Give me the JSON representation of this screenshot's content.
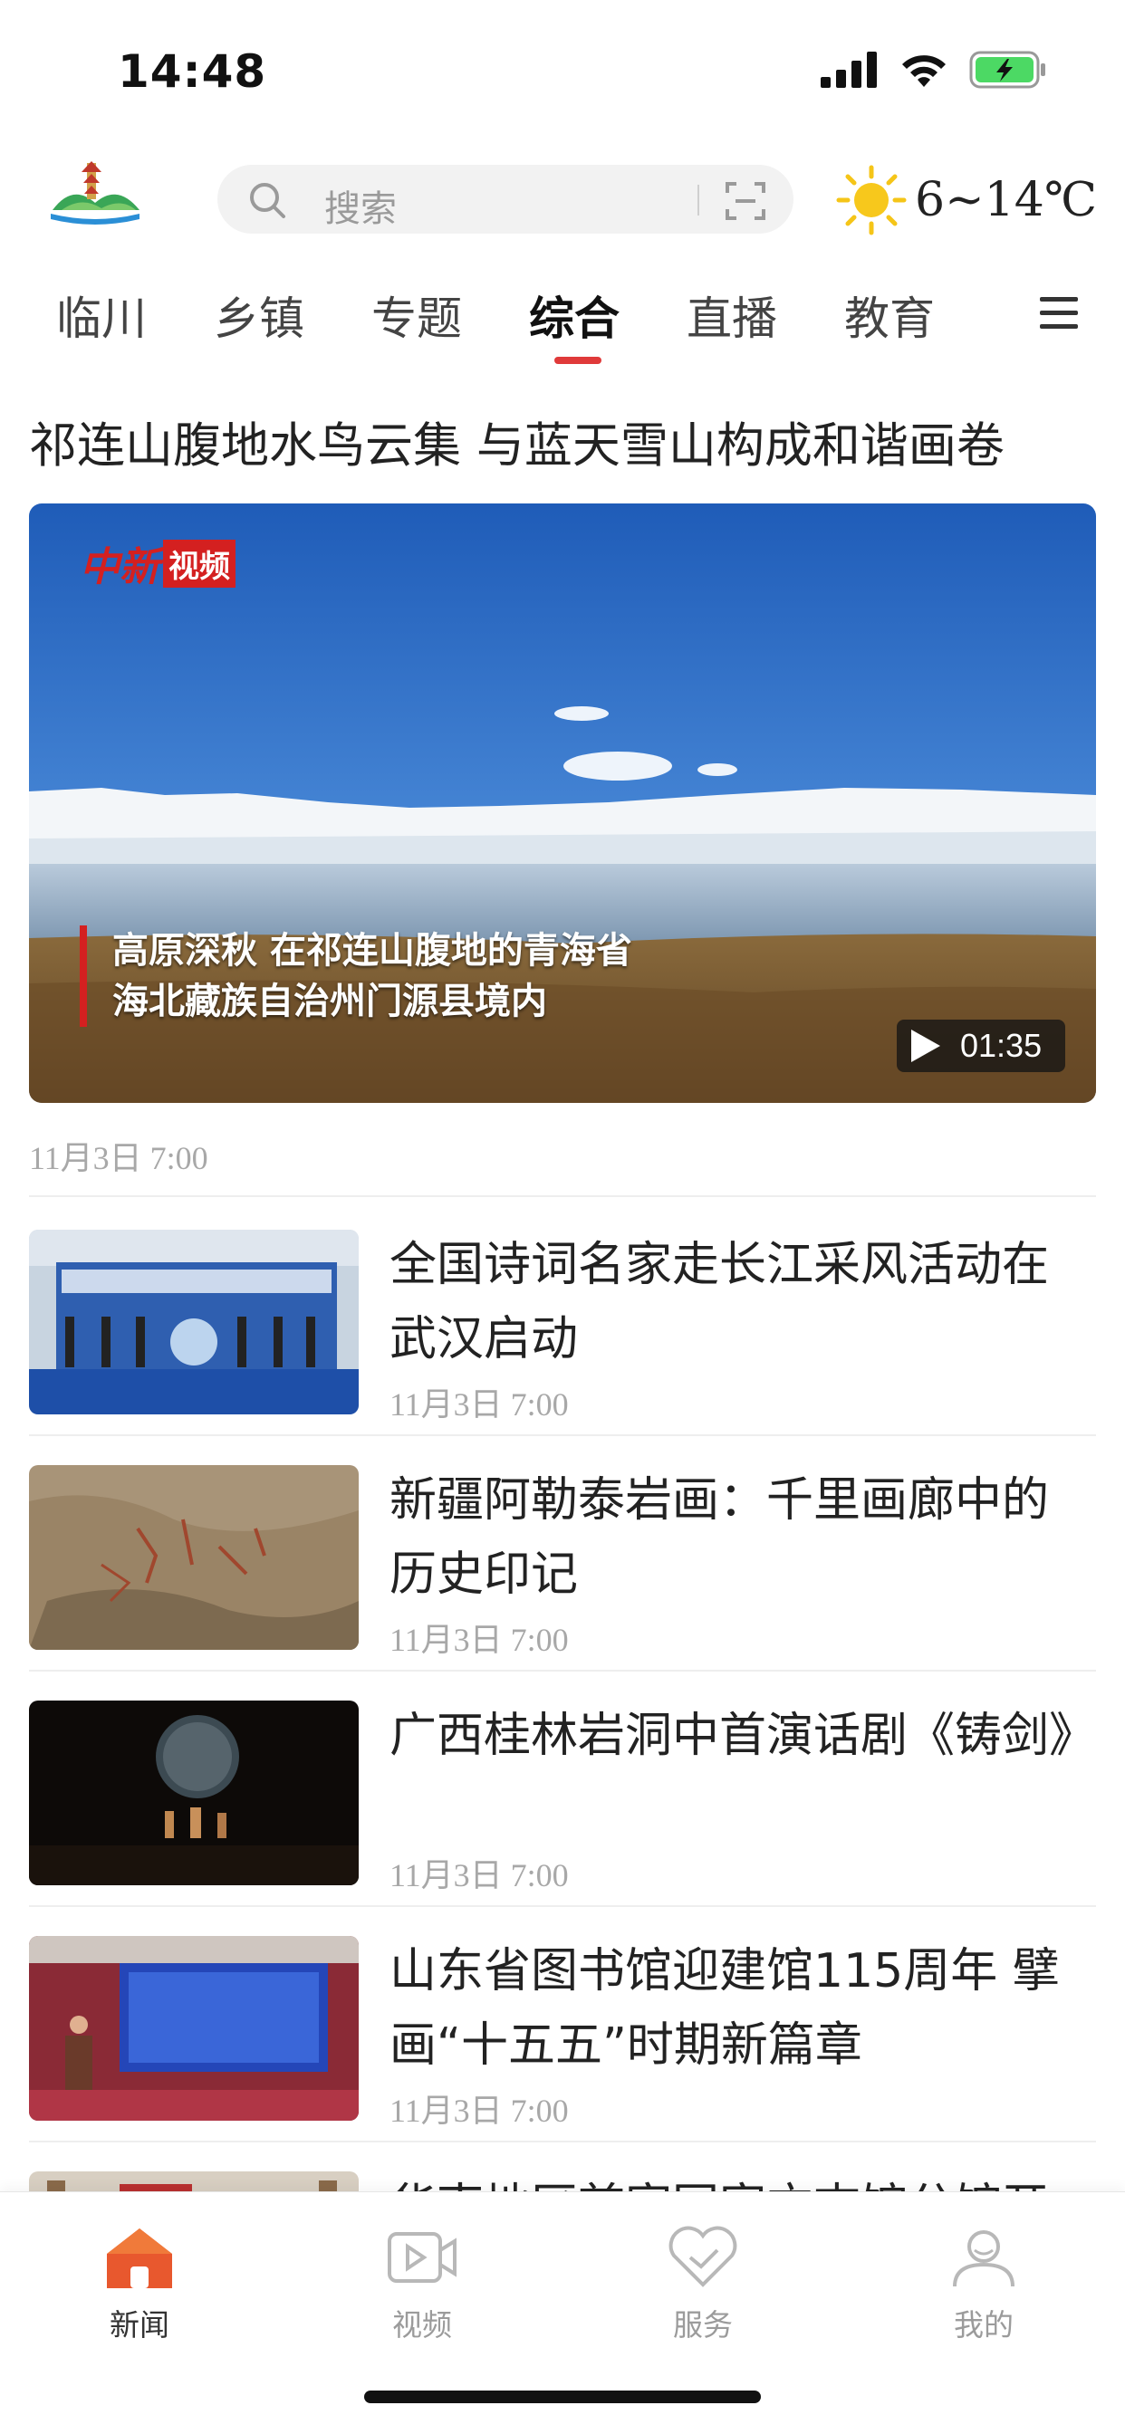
{
  "status_bar": {
    "time": "14:48"
  },
  "header": {
    "search_placeholder": "搜索",
    "weather": {
      "temperature": "6~14℃",
      "icon": "sun-icon"
    }
  },
  "tabs": [
    {
      "label": "临川",
      "active": false
    },
    {
      "label": "乡镇",
      "active": false
    },
    {
      "label": "专题",
      "active": false
    },
    {
      "label": "综合",
      "active": true
    },
    {
      "label": "直播",
      "active": false
    },
    {
      "label": "教育",
      "active": false
    }
  ],
  "featured": {
    "title": "祁连山腹地水鸟云集  与蓝天雪山构成和谐画卷",
    "video_logo_a": "中新",
    "video_logo_b": "视频",
    "caption_line1": "高原深秋  在祁连山腹地的青海省",
    "caption_line2": "海北藏族自治州门源县境内",
    "duration": "01:35",
    "date": "11月3日  7:00"
  },
  "news": [
    {
      "title": "全国诗词名家走长江采风活动在武汉启动",
      "date": "11月3日  7:00"
    },
    {
      "title": "新疆阿勒泰岩画：千里画廊中的历史印记",
      "date": "11月3日  7:00"
    },
    {
      "title": "广西桂林岩洞中首演话剧《铸剑》",
      "date": "11月3日  7:00"
    },
    {
      "title": "山东省图书馆迎建馆115周年  擘画“十五五”时期新篇章",
      "date": "11月3日  7:00"
    },
    {
      "title": "华南地区首家国家方志馆分馆开",
      "date": ""
    }
  ],
  "bottom_nav": [
    {
      "label": "新闻",
      "icon": "home-icon",
      "active": true
    },
    {
      "label": "视频",
      "icon": "video-icon",
      "active": false
    },
    {
      "label": "服务",
      "icon": "heart-icon",
      "active": false
    },
    {
      "label": "我的",
      "icon": "user-icon",
      "active": false
    }
  ],
  "colors": {
    "accent": "#e03a3a",
    "muted": "#a8a8a8"
  }
}
